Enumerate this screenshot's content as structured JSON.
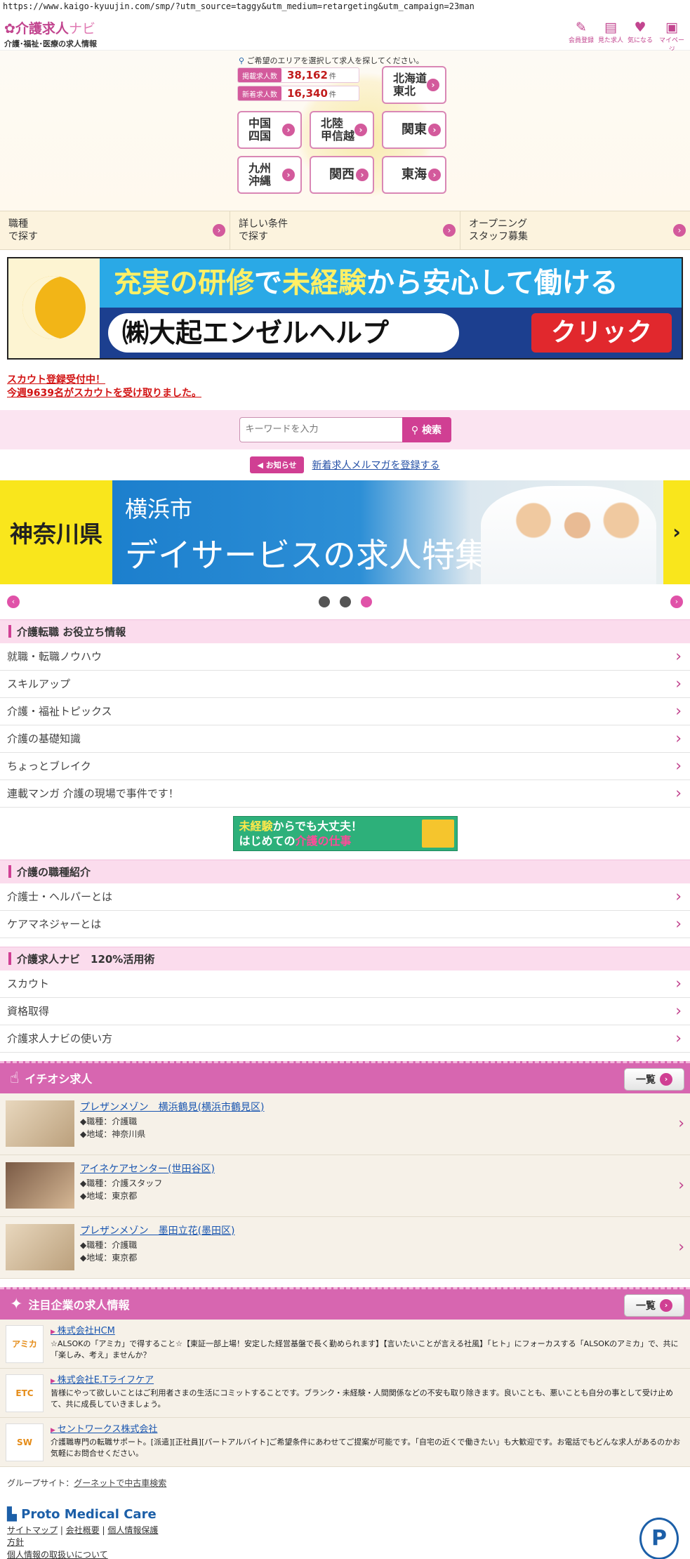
{
  "browser": {
    "url": "https://www.kaigo-kyuujin.com/smp/?utm_source=taggy&utm_medium=retargeting&utm_campaign=23man"
  },
  "header": {
    "logo_main": "介護求人",
    "logo_accent": "ナビ",
    "logo_sub": "介護･福祉･医療の求人情報",
    "icons": [
      {
        "name": "pencil-icon",
        "label": "会員登録"
      },
      {
        "name": "clipboard-icon",
        "label": "見た求人"
      },
      {
        "name": "heart-icon",
        "label": "気になる"
      },
      {
        "name": "person-icon",
        "label": "マイページ"
      }
    ]
  },
  "area": {
    "hint": "ご希望のエリアを選択して求人を探してください。",
    "posted_label": "掲載求人数",
    "posted_count": "38,162",
    "new_label": "新着求人数",
    "new_count": "16,340",
    "unit": "件",
    "regions": {
      "hokkaido": "北海道\n東北",
      "chugoku": "中国\n四国",
      "hokuriku": "北陸\n甲信越",
      "kanto": "関東",
      "kyushu": "九州\n沖縄",
      "kansai": "関西",
      "tokai": "東海"
    }
  },
  "search_tabs": [
    "職種\nで探す",
    "詳しい条件\nで探す",
    "オープニング\nスタッフ募集"
  ],
  "banner_ad": {
    "top_pre": "充実の研修",
    "top_mid": "で",
    "top_mid2": "未経験",
    "top_post": "から安心して働ける",
    "company": "㈱大起エンゼルヘルプ",
    "click": "クリック"
  },
  "scout": {
    "line1": "スカウト登録受付中！",
    "line2": "今週9639名がスカウトを受け取りました。"
  },
  "search": {
    "placeholder": "キーワードを入力",
    "button": "検索"
  },
  "notice": {
    "tag": "お知らせ",
    "link": "新着求人メルマガを登録する"
  },
  "slider": {
    "pref": "神奈川県",
    "city": "横浜市",
    "title": "デイサービスの求人特集",
    "next": "›",
    "dots": 3,
    "active": 2
  },
  "section_tips": {
    "title": "介護転職 お役立ち情報",
    "items": [
      "就職・転職ノウハウ",
      "スキルアップ",
      "介護・福祉トピックス",
      "介護の基礎知識",
      "ちょっとブレイク",
      "連載マンガ 介護の現場で事件です！"
    ]
  },
  "small_banner": {
    "line1a": "未経験",
    "line1b": "からでも大丈夫！",
    "line2a": "はじめての",
    "line2b": "介護の仕事"
  },
  "section_jobs": {
    "title": "介護の職種紹介",
    "items": [
      "介護士・ヘルパーとは",
      "ケアマネジャーとは"
    ]
  },
  "section_usage": {
    "title": "介護求人ナビ　120%活用術",
    "items": [
      "スカウト",
      "資格取得",
      "介護求人ナビの使い方"
    ]
  },
  "featured": {
    "title": "イチオシ求人",
    "more": "一覧",
    "jobs": [
      {
        "name": "プレザンメゾン　横浜鶴見(横浜市鶴見区)",
        "type": "◆職種：介護職",
        "area": "◆地域：神奈川県"
      },
      {
        "name": "アイネケアセンター(世田谷区)",
        "type": "◆職種：介護スタッフ",
        "area": "◆地域：東京都"
      },
      {
        "name": "プレザンメゾン　墨田立花(墨田区)",
        "type": "◆職種：介護職",
        "area": "◆地域：東京都"
      }
    ]
  },
  "companies": {
    "title": "注目企業の求人情報",
    "more": "一覧",
    "items": [
      {
        "logo": "アミカ",
        "name": "株式会社HCM",
        "desc": "☆ALSOKの「アミカ」で得すること☆【東証一部上場！安定した経営基盤で長く勤められます】【言いたいことが言える社風】「ヒト」にフォーカスする「ALSOKのアミカ」で、共に「楽しみ、考え」ませんか？"
      },
      {
        "logo": "ETC",
        "name": "株式会社E.Tライフケア",
        "desc": "皆様にやって欲しいことはご利用者さまの生活にコミットすることです。ブランク・未経験・人間関係などの不安も取り除きます。良いことも、悪いことも自分の事として受け止めて、共に成長していきましょう。"
      },
      {
        "logo": "SW",
        "name": "セントワークス株式会社",
        "desc": "介護職専門の転職サポート。[派遣][正社員][パートアルバイト]ご希望条件にあわせてご提案が可能です。「自宅の近くで働きたい」も大歓迎です。お電話でもどんな求人があるのかお気軽にお問合せください。"
      }
    ]
  },
  "footer": {
    "group_label": "グループサイト：",
    "group_link": "グーネットで中古車検索",
    "brand": "Proto Medical Care",
    "links": [
      "サイトマップ",
      "会社概要",
      "個人情報保護",
      "方針",
      "個人情報の取扱いについて"
    ]
  }
}
